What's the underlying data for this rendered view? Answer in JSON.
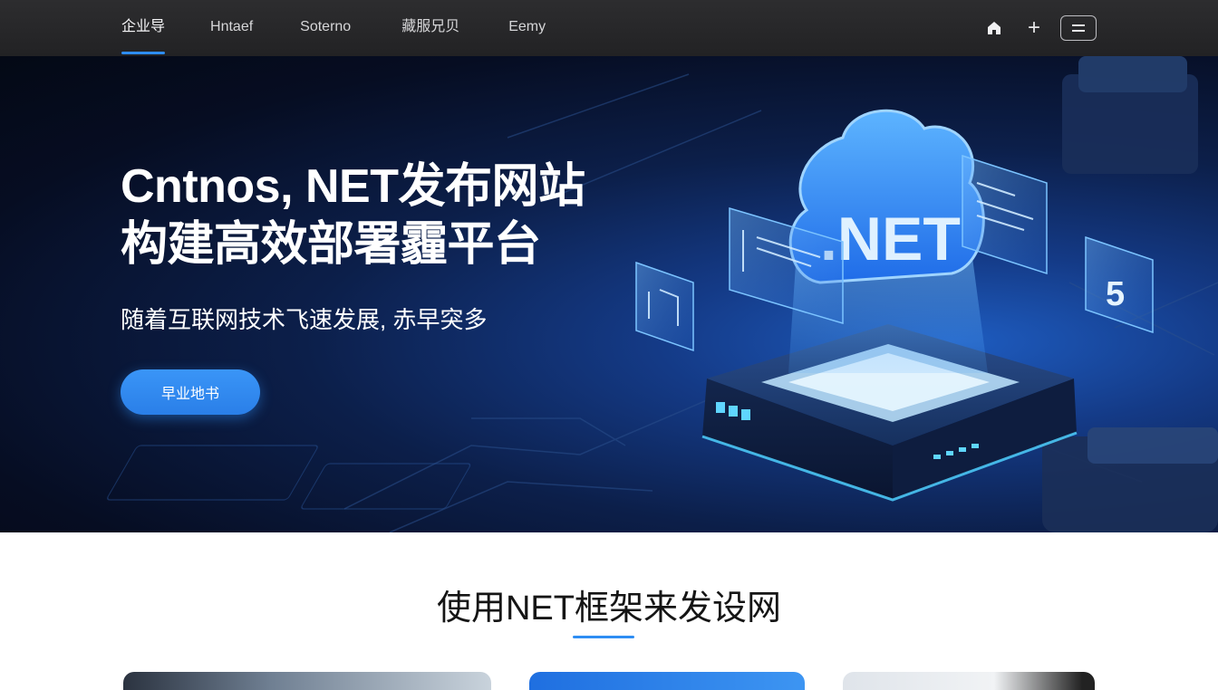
{
  "nav": {
    "items": [
      {
        "label": "企业导",
        "active": true
      },
      {
        "label": "Hntaef",
        "active": false
      },
      {
        "label": "Soterno",
        "active": false
      },
      {
        "label": "藏服兄贝",
        "active": false
      },
      {
        "label": "Eemy",
        "active": false
      }
    ],
    "actions": {
      "home_icon": "home-icon",
      "plus_icon": "plus-icon",
      "plus_label": "+",
      "menu_icon": "menu-icon"
    }
  },
  "hero": {
    "title_line1": "Cntnos, NET发布网站",
    "title_line2": "构建高效部署霾平台",
    "subtitle": "随着互联网技术飞速发展, 赤早突多",
    "cta_label": "早业地书",
    "illustration_text": ".NET",
    "illustration_badge": "5"
  },
  "section": {
    "title": "使用NET框架来发设网"
  },
  "colors": {
    "accent": "#2e8df3",
    "topbar": "#262628",
    "hero_dark": "#060d22",
    "hero_glow": "#1e5cc0"
  }
}
